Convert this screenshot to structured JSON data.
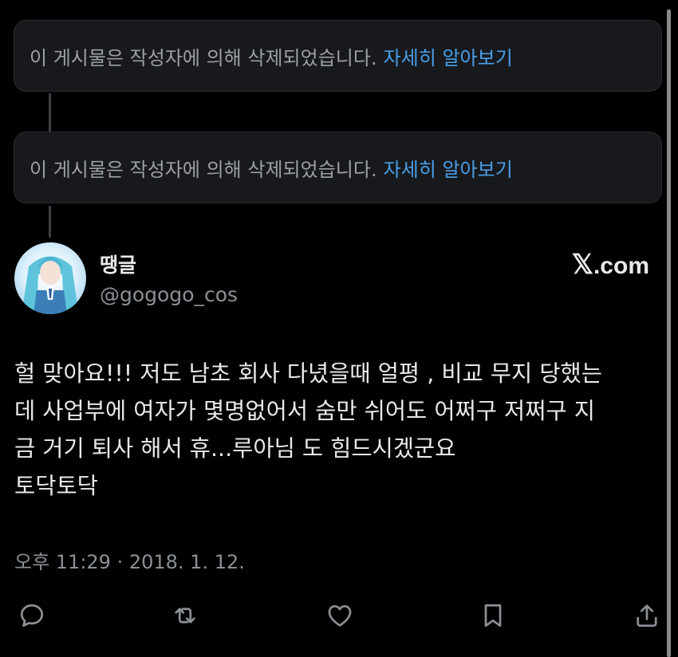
{
  "deleted_notices": [
    {
      "message": "이 게시물은 작성자에 의해 삭제되었습니다.",
      "link": "자세히 알아보기"
    },
    {
      "message": "이 게시물은 작성자에 의해 삭제되었습니다.",
      "link": "자세히 알아보기"
    }
  ],
  "author": {
    "display_name": "땡글",
    "handle": "@gogogo_cos"
  },
  "brand": {
    "x": "𝕏",
    "domain": ".com"
  },
  "tweet": {
    "lines": [
      "헐 맞아요!!! 저도 남초 회사 다녔을때 얼평 , 비교 무지 당했는",
      "데 사업부에 여자가 몇명없어서 숨만 쉬어도 어쩌구 저쩌구 지",
      "금 거기 퇴사 해서 휴...루아님 도 힘드시겠군요",
      "토닥토닥"
    ],
    "timestamp": "오후 11:29 · 2018. 1. 12."
  },
  "actions": {
    "icons": [
      "reply-icon",
      "retweet-icon",
      "like-icon",
      "bookmark-icon",
      "share-icon"
    ]
  },
  "colors": {
    "background": "#000000",
    "card": "#17191c",
    "link": "#4a9fe8",
    "text": "#e7e9ea",
    "muted": "#8b9096"
  }
}
